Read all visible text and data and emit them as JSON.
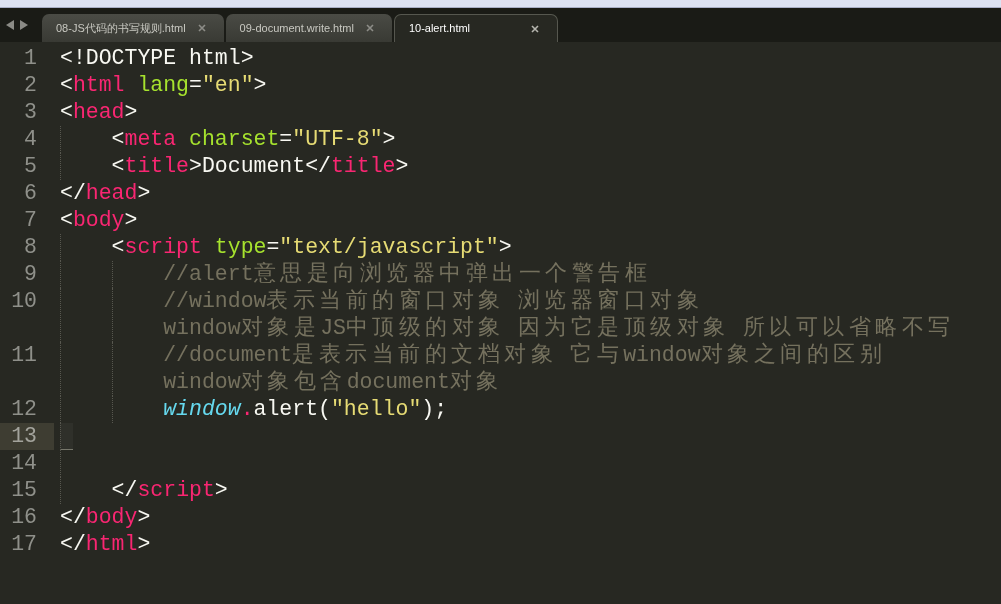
{
  "tabs": [
    {
      "label": "08-JS代码的书写规则.html",
      "selected": false
    },
    {
      "label": "09-document.write.html",
      "selected": false
    },
    {
      "label": "10-alert.html",
      "selected": true
    }
  ],
  "editor": {
    "lines": [
      {
        "number": "1",
        "current": false,
        "rows": [
          [
            {
              "kind": "plain",
              "text": "<!DOCTYPE html>"
            }
          ]
        ]
      },
      {
        "number": "2",
        "current": false,
        "rows": [
          [
            {
              "kind": "plain",
              "text": "<"
            },
            {
              "kind": "keyword",
              "text": "html"
            },
            {
              "kind": "attr",
              "text": " lang"
            },
            {
              "kind": "plain",
              "text": "="
            },
            {
              "kind": "string",
              "text": "\"en\""
            },
            {
              "kind": "plain",
              "text": ">"
            }
          ]
        ]
      },
      {
        "number": "3",
        "current": false,
        "rows": [
          [
            {
              "kind": "plain",
              "text": "<"
            },
            {
              "kind": "keyword",
              "text": "head"
            },
            {
              "kind": "plain",
              "text": ">"
            }
          ]
        ]
      },
      {
        "number": "4",
        "current": false,
        "rows": [
          [
            {
              "kind": "plain",
              "text": "    <"
            },
            {
              "kind": "keyword",
              "text": "meta"
            },
            {
              "kind": "attr",
              "text": " charset"
            },
            {
              "kind": "plain",
              "text": "="
            },
            {
              "kind": "string",
              "text": "\"UTF-8\""
            },
            {
              "kind": "plain",
              "text": ">"
            }
          ]
        ]
      },
      {
        "number": "5",
        "current": false,
        "rows": [
          [
            {
              "kind": "plain",
              "text": "    <"
            },
            {
              "kind": "keyword",
              "text": "title"
            },
            {
              "kind": "plain",
              "text": ">Document</"
            },
            {
              "kind": "keyword",
              "text": "title"
            },
            {
              "kind": "plain",
              "text": ">"
            }
          ]
        ]
      },
      {
        "number": "6",
        "current": false,
        "rows": [
          [
            {
              "kind": "plain",
              "text": "</"
            },
            {
              "kind": "keyword",
              "text": "head"
            },
            {
              "kind": "plain",
              "text": ">"
            }
          ]
        ]
      },
      {
        "number": "7",
        "current": false,
        "rows": [
          [
            {
              "kind": "plain",
              "text": "<"
            },
            {
              "kind": "keyword",
              "text": "body"
            },
            {
              "kind": "plain",
              "text": ">"
            }
          ]
        ]
      },
      {
        "number": "8",
        "current": false,
        "rows": [
          [
            {
              "kind": "plain",
              "text": "    <"
            },
            {
              "kind": "keyword",
              "text": "script"
            },
            {
              "kind": "attr",
              "text": " type"
            },
            {
              "kind": "plain",
              "text": "="
            },
            {
              "kind": "string",
              "text": "\"text/javascript\""
            },
            {
              "kind": "plain",
              "text": ">"
            }
          ]
        ]
      },
      {
        "number": "9",
        "current": false,
        "rows": [
          [
            {
              "kind": "comment",
              "text": "        //alert意思是向浏览器中弹出一个警告框"
            }
          ]
        ]
      },
      {
        "number": "10",
        "current": false,
        "rows": [
          [
            {
              "kind": "comment",
              "text": "        //window表示当前的窗口对象 浏览器窗口对象"
            }
          ],
          [
            {
              "kind": "comment",
              "text": "window对象是JS中顶级的对象 因为它是顶级对象 所以可以省略不写"
            }
          ]
        ]
      },
      {
        "number": "11",
        "current": false,
        "rows": [
          [
            {
              "kind": "comment",
              "text": "        //document是表示当前的文档对象 它与window对象之间的区别"
            }
          ],
          [
            {
              "kind": "comment",
              "text": "window对象包含document对象"
            }
          ]
        ]
      },
      {
        "number": "12",
        "current": false,
        "rows": [
          [
            {
              "kind": "builtin",
              "text": "        window"
            },
            {
              "kind": "keyword",
              "text": "."
            },
            {
              "kind": "plain",
              "text": "alert("
            },
            {
              "kind": "string",
              "text": "\"hello\""
            },
            {
              "kind": "plain",
              "text": ");"
            }
          ]
        ]
      },
      {
        "number": "13",
        "current": true
      },
      {
        "number": "14",
        "current": false
      },
      {
        "number": "15",
        "current": false,
        "rows": [
          [
            {
              "kind": "plain",
              "text": "    </"
            },
            {
              "kind": "keyword",
              "text": "script"
            },
            {
              "kind": "plain",
              "text": ">"
            }
          ]
        ]
      },
      {
        "number": "16",
        "current": false,
        "rows": [
          [
            {
              "kind": "plain",
              "text": "</"
            },
            {
              "kind": "keyword",
              "text": "body"
            },
            {
              "kind": "plain",
              "text": ">"
            }
          ]
        ]
      },
      {
        "number": "17",
        "current": false,
        "rows": [
          [
            {
              "kind": "plain",
              "text": "</"
            },
            {
              "kind": "keyword",
              "text": "html"
            },
            {
              "kind": "plain",
              "text": ">"
            }
          ]
        ]
      }
    ]
  }
}
